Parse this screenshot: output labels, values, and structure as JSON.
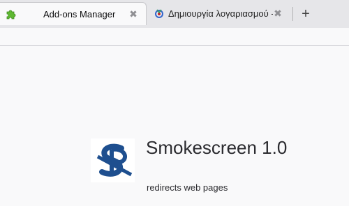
{
  "tabs": [
    {
      "label": "Add-ons Manager",
      "favicon": "puzzle-icon",
      "active": true
    },
    {
      "label": "Δημιουργία λογαριασμού - ...",
      "favicon": "wikimedia-icon",
      "active": false
    }
  ],
  "tab_close_glyph": "✖",
  "new_tab_glyph": "+",
  "addon": {
    "name": "Smokescreen 1.0",
    "description": "redirects web pages",
    "icon": "smokescreen-logo-icon"
  },
  "colors": {
    "accent_green": "#5fb832",
    "logo_blue": "#1e4f8f"
  }
}
